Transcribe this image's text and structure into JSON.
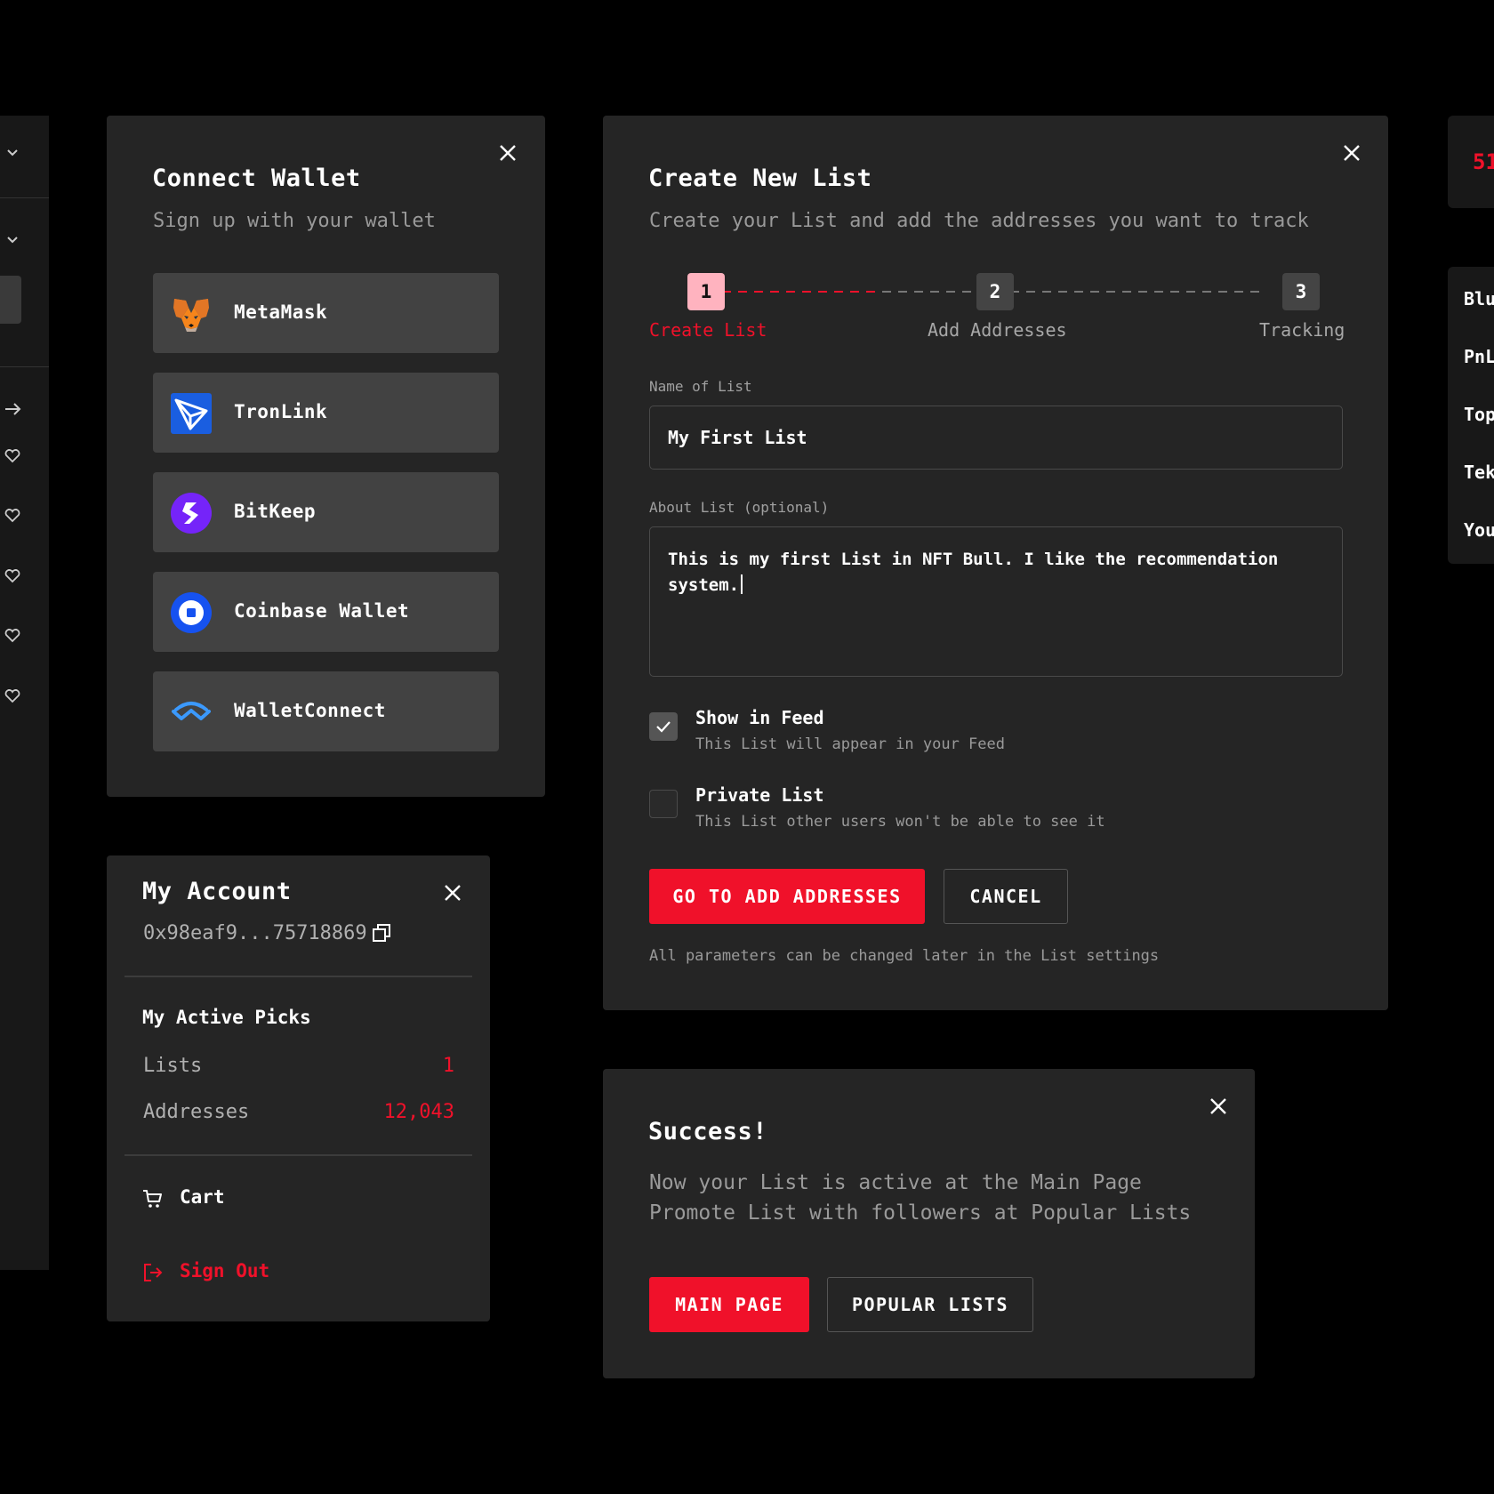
{
  "left_strip": {
    "icons": [
      "chevron-down-icon",
      "chevron-down-icon",
      "arrow-right-icon",
      "heart-icon",
      "heart-icon",
      "heart-icon",
      "heart-icon",
      "heart-icon"
    ]
  },
  "connect_wallet": {
    "title": "Connect Wallet",
    "subtitle": "Sign up with your wallet",
    "wallets": [
      {
        "label": "MetaMask",
        "icon": "metamask-icon"
      },
      {
        "label": "TronLink",
        "icon": "tronlink-icon"
      },
      {
        "label": "BitKeep",
        "icon": "bitkeep-icon"
      },
      {
        "label": "Coinbase Wallet",
        "icon": "coinbase-icon"
      },
      {
        "label": "WalletConnect",
        "icon": "walletconnect-icon"
      }
    ]
  },
  "account": {
    "title": "My Account",
    "address": "0x98eaf9...75718869",
    "section_title": "My Active Picks",
    "rows": [
      {
        "label": "Lists",
        "value": "1"
      },
      {
        "label": "Addresses",
        "value": "12,043"
      }
    ],
    "cart_label": "Cart",
    "signout_label": "Sign Out"
  },
  "create_list": {
    "title": "Create New List",
    "subtitle": "Create your List and add the addresses you want to track",
    "steps": [
      {
        "num": "1",
        "label": "Create List",
        "state": "active"
      },
      {
        "num": "2",
        "label": "Add Addresses",
        "state": "inactive"
      },
      {
        "num": "3",
        "label": "Tracking",
        "state": "inactive"
      }
    ],
    "name_label": "Name of List",
    "name_value": "My First List",
    "about_label": "About List (optional)",
    "about_value": "This is my first List in NFT Bull. I like the recommendation system.",
    "options": [
      {
        "title": "Show in Feed",
        "sub": "This List will appear in your Feed",
        "checked": true
      },
      {
        "title": "Private List",
        "sub": "This List other users won't be able to see it",
        "checked": false
      }
    ],
    "primary_button": "GO TO ADD ADDRESSES",
    "cancel_button": "CANCEL",
    "footnote": "All parameters can be changed later in the List settings"
  },
  "success": {
    "title": "Success!",
    "line1": "Now your List is active at the Main Page",
    "line2": "Promote List with followers at Popular Lists",
    "primary_button": "MAIN PAGE",
    "secondary_button": "POPULAR LISTS"
  },
  "right_strip": {
    "top_value": "51",
    "items": [
      "Blu",
      "PnL",
      "Top",
      "Tek",
      "You"
    ]
  },
  "colors": {
    "accent": "#f0112a",
    "panel": "#252525",
    "background": "#000000",
    "button_gray": "#424242"
  }
}
